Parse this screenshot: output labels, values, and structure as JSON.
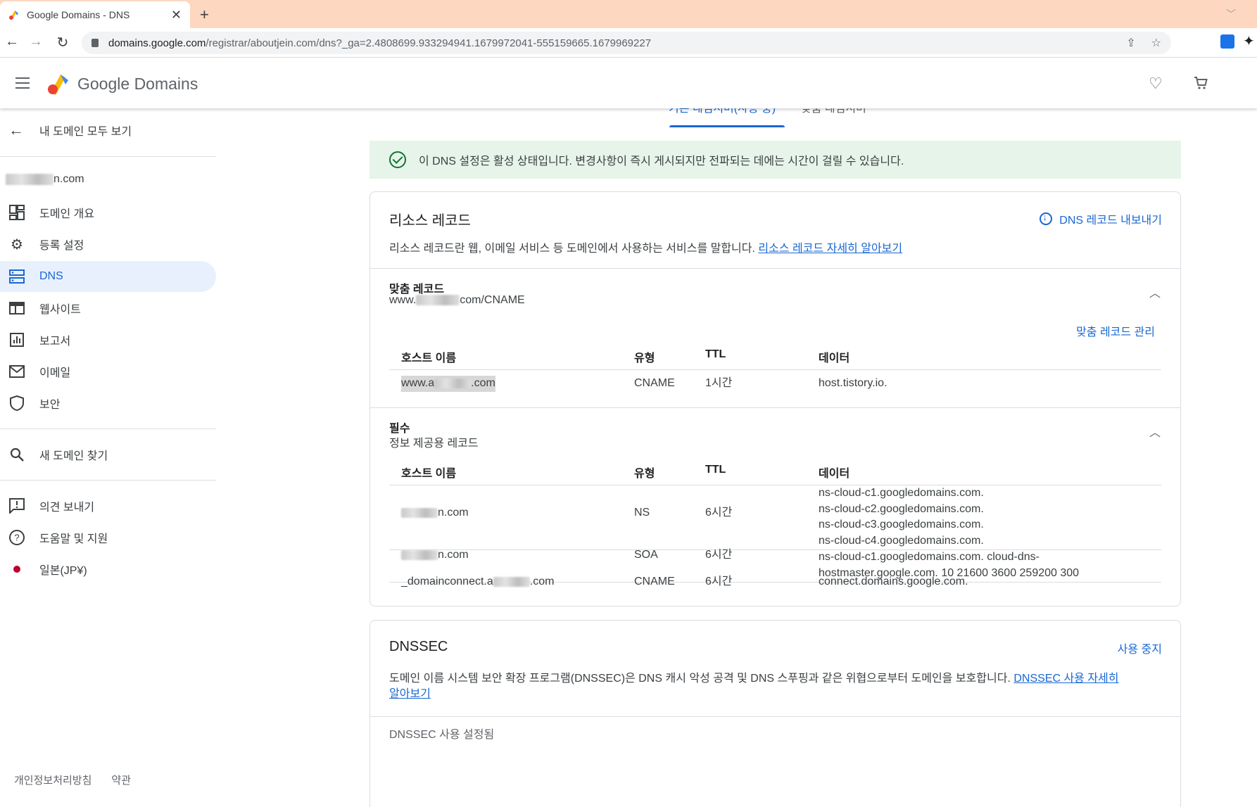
{
  "browser": {
    "tab_title": "Google Domains - DNS",
    "close_glyph": "✕",
    "new_tab_glyph": "+",
    "url_host": "domains.google.com",
    "url_path": "/registrar/aboutjein.com/dns?_ga=2.4808699.933294941.1679972041-555159665.1679969227"
  },
  "app": {
    "logo_text_1": "Google",
    "logo_text_2": "Domains"
  },
  "sidebar": {
    "back_label": "내 도메인 모두 보기",
    "domain_suffix": "n.com",
    "items": [
      {
        "label": "도메인 개요",
        "icon": "dashboard-icon"
      },
      {
        "label": "등록 설정",
        "icon": "gear-icon"
      },
      {
        "label": "DNS",
        "icon": "dns-icon"
      },
      {
        "label": "웹사이트",
        "icon": "website-icon"
      },
      {
        "label": "보고서",
        "icon": "report-icon"
      },
      {
        "label": "이메일",
        "icon": "mail-icon"
      },
      {
        "label": "보안",
        "icon": "shield-icon"
      },
      {
        "label": "새 도메인 찾기",
        "icon": "search-icon"
      },
      {
        "label": "의견 보내기",
        "icon": "feedback-icon"
      },
      {
        "label": "도움말 및 지원",
        "icon": "help-icon"
      },
      {
        "label": "일본(JP¥)",
        "icon": "japan-flag-icon"
      }
    ],
    "footer": {
      "privacy": "개인정보처리방침",
      "terms": "약관"
    }
  },
  "main": {
    "subtabs": [
      "기본 네임서버(사용 중)",
      "맞춤 네임서버"
    ],
    "banner_text": "이 DNS 설정은 활성 상태입니다. 변경사항이 즉시 게시되지만 전파되는 데에는 시간이 걸릴 수 있습니다.",
    "resource": {
      "title": "리소스 레코드",
      "export_label": "DNS 레코드 내보내기",
      "desc": "리소스 레코드란 웹, 이메일 서비스 등 도메인에서 사용하는 서비스를 말합니다.",
      "desc_link": "리소스 레코드 자세히 알아보기",
      "custom": {
        "title": "맞춤 레코드",
        "sub_prefix": "www.",
        "sub_suffix": "com/CNAME",
        "manage": "맞춤 레코드 관리",
        "headers": {
          "host": "호스트 이름",
          "type": "유형",
          "ttl": "TTL",
          "data": "데이터"
        },
        "rows": [
          {
            "host_prefix": "www.a",
            "host_suffix": ".com",
            "type": "CNAME",
            "ttl": "1시간",
            "data": "host.tistory.io."
          }
        ]
      },
      "required": {
        "title": "필수",
        "sub": "정보 제공용 레코드",
        "headers": {
          "host": "호스트 이름",
          "type": "유형",
          "ttl": "TTL",
          "data": "데이터"
        },
        "rows": [
          {
            "host_suffix": "n.com",
            "type": "NS",
            "ttl": "6시간",
            "data": [
              "ns-cloud-c1.googledomains.com.",
              "ns-cloud-c2.googledomains.com.",
              "ns-cloud-c3.googledomains.com.",
              "ns-cloud-c4.googledomains.com."
            ]
          },
          {
            "host_suffix": "n.com",
            "type": "SOA",
            "ttl": "6시간",
            "data": [
              "ns-cloud-c1.googledomains.com. cloud-dns-",
              "hostmaster.google.com. 10 21600 3600 259200 300"
            ]
          },
          {
            "host_prefix": "_domainconnect.a",
            "host_suffix": ".com",
            "type": "CNAME",
            "ttl": "6시간",
            "data": [
              "connect.domains.google.com."
            ]
          }
        ]
      }
    },
    "dnssec": {
      "title": "DNSSEC",
      "action": "사용 중지",
      "desc": "도메인 이름 시스템 보안 확장 프로그램(DNSSEC)은 DNS 캐시 악성 공격 및 DNS 스푸핑과 같은 위협으로부터 도메인을 보호합니다.",
      "link_1": "DNSSEC 사용 자세히",
      "link_2": "알아보기",
      "next_section": "DNSSEC 사용 설정됨"
    }
  }
}
